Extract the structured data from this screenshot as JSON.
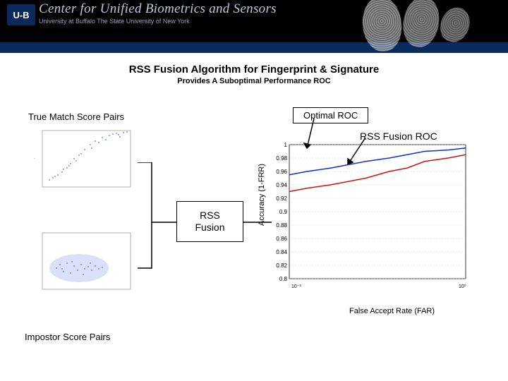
{
  "banner": {
    "logo_text": "U-B",
    "title": "Center for Unified Biometrics and Sensors",
    "subtitle": "University at Buffalo  The State University of New York"
  },
  "heading": {
    "line1": "RSS Fusion Algorithm for Fingerprint & Signature",
    "line2": "Provides A Suboptimal Performance ROC"
  },
  "labels": {
    "true_match": "True Match Score Pairs",
    "impostor": "Impostor Score Pairs",
    "optimal_roc": "Optimal ROC",
    "rss_roc": "RSS Fusion ROC",
    "rss_fusion": "RSS\nFusion",
    "yaxis": "Accuracy (1-FRR)",
    "xaxis": "False Accept Rate (FAR)"
  },
  "chart_data": {
    "type": "line",
    "title": "ROC",
    "xlabel": "False Accept Rate (FAR)",
    "ylabel": "Accuracy (1-FRR)",
    "ylim": [
      0.8,
      1.0
    ],
    "yticks": [
      0.8,
      0.82,
      0.84,
      0.86,
      0.88,
      0.9,
      0.92,
      0.94,
      0.96,
      0.98,
      1.0
    ],
    "series": [
      {
        "name": "Optimal ROC",
        "color": "#1030d0",
        "x": [
          0.001,
          0.002,
          0.005,
          0.01,
          0.02,
          0.05,
          0.1,
          0.2,
          0.5,
          1.0
        ],
        "y": [
          0.955,
          0.96,
          0.965,
          0.97,
          0.975,
          0.98,
          0.985,
          0.99,
          0.992,
          0.995
        ]
      },
      {
        "name": "RSS Fusion ROC",
        "color": "#d01010",
        "x": [
          0.001,
          0.002,
          0.005,
          0.01,
          0.02,
          0.05,
          0.1,
          0.2,
          0.5,
          1.0
        ],
        "y": [
          0.93,
          0.935,
          0.94,
          0.945,
          0.95,
          0.96,
          0.965,
          0.975,
          0.98,
          0.985
        ]
      }
    ]
  }
}
